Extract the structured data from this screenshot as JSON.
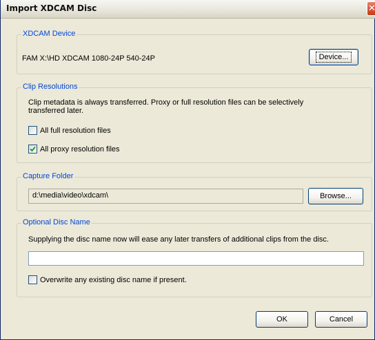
{
  "window": {
    "title": "Import XDCAM Disc",
    "close_symbol": "✕"
  },
  "device_group": {
    "legend": "XDCAM Device",
    "device_name": "FAM X:\\HD XDCAM 1080-24P 540-24P",
    "button_label": "Device..."
  },
  "clip_group": {
    "legend": "Clip Resolutions",
    "description_line1": "Clip metadata is always transferred. Proxy or full resolution files can be selectively",
    "description_line2": "transferred later.",
    "full_label": "All full resolution files",
    "full_checked": false,
    "proxy_label": "All proxy resolution files",
    "proxy_checked": true
  },
  "capture_group": {
    "legend": "Capture Folder",
    "folder_path": "d:\\media\\video\\xdcam\\",
    "button_label": "Browse..."
  },
  "disc_group": {
    "legend": "Optional Disc Name",
    "description": "Supplying the disc name now will ease any later transfers of additional clips from the disc.",
    "name_value": "",
    "overwrite_label": "Overwrite any existing disc name if present.",
    "overwrite_checked": false
  },
  "footer": {
    "ok_label": "OK",
    "cancel_label": "Cancel"
  },
  "colors": {
    "legend": "#0046d5",
    "dialog_bg": "#ece9d8",
    "close_red": "#c33a17"
  }
}
